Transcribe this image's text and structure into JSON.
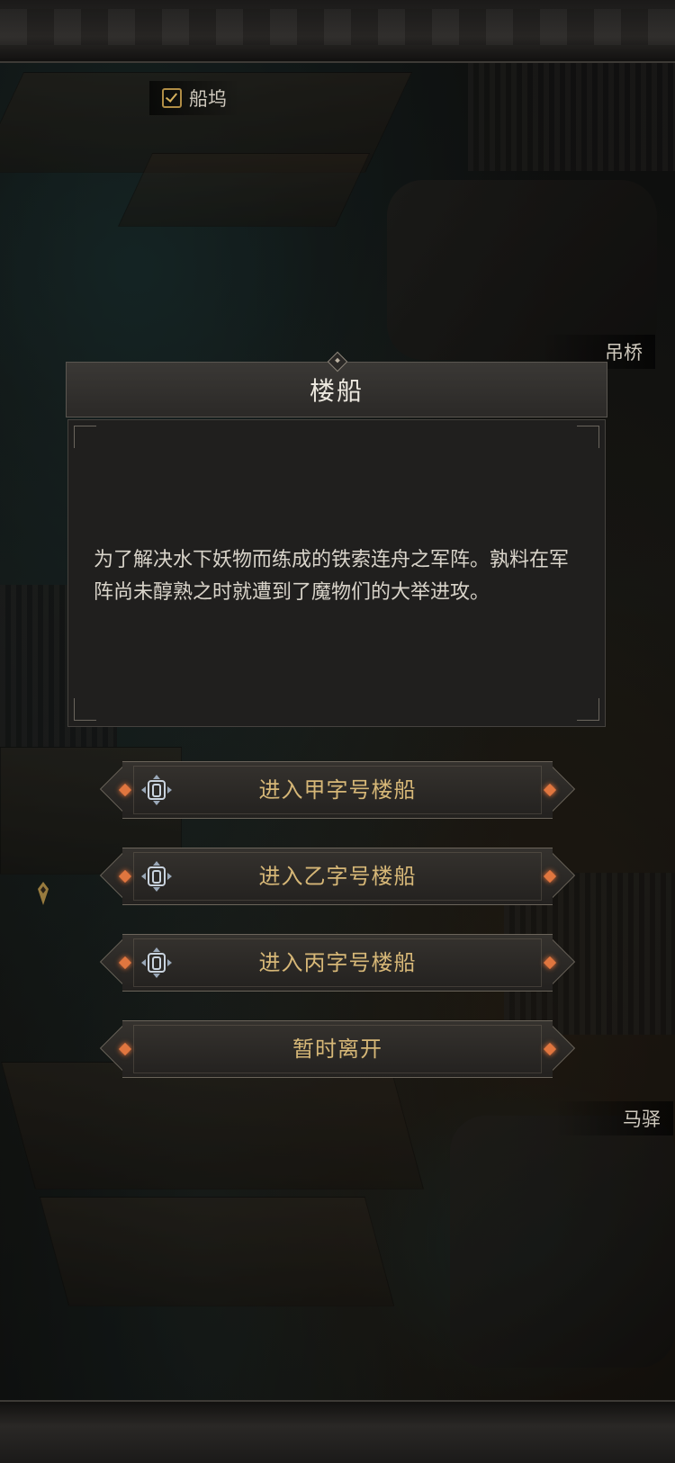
{
  "map": {
    "locations": [
      {
        "label": "船坞",
        "checked": true
      },
      {
        "label": "吊桥"
      },
      {
        "label": "马驿"
      }
    ]
  },
  "dialog": {
    "title": "楼船",
    "description": "为了解决水下妖物而练成的铁索连舟之军阵。孰料在军阵尚未醇熟之时就遭到了魔物们的大举进攻。"
  },
  "buttons": [
    {
      "label": "进入甲字号楼船",
      "icon": "gate-icon"
    },
    {
      "label": "进入乙字号楼船",
      "icon": "gate-icon"
    },
    {
      "label": "进入丙字号楼船",
      "icon": "gate-icon"
    },
    {
      "label": "暂时离开"
    }
  ],
  "colors": {
    "accent_gold": "#d6b777",
    "accent_orange": "#e0763f",
    "panel": "#201f1e"
  }
}
